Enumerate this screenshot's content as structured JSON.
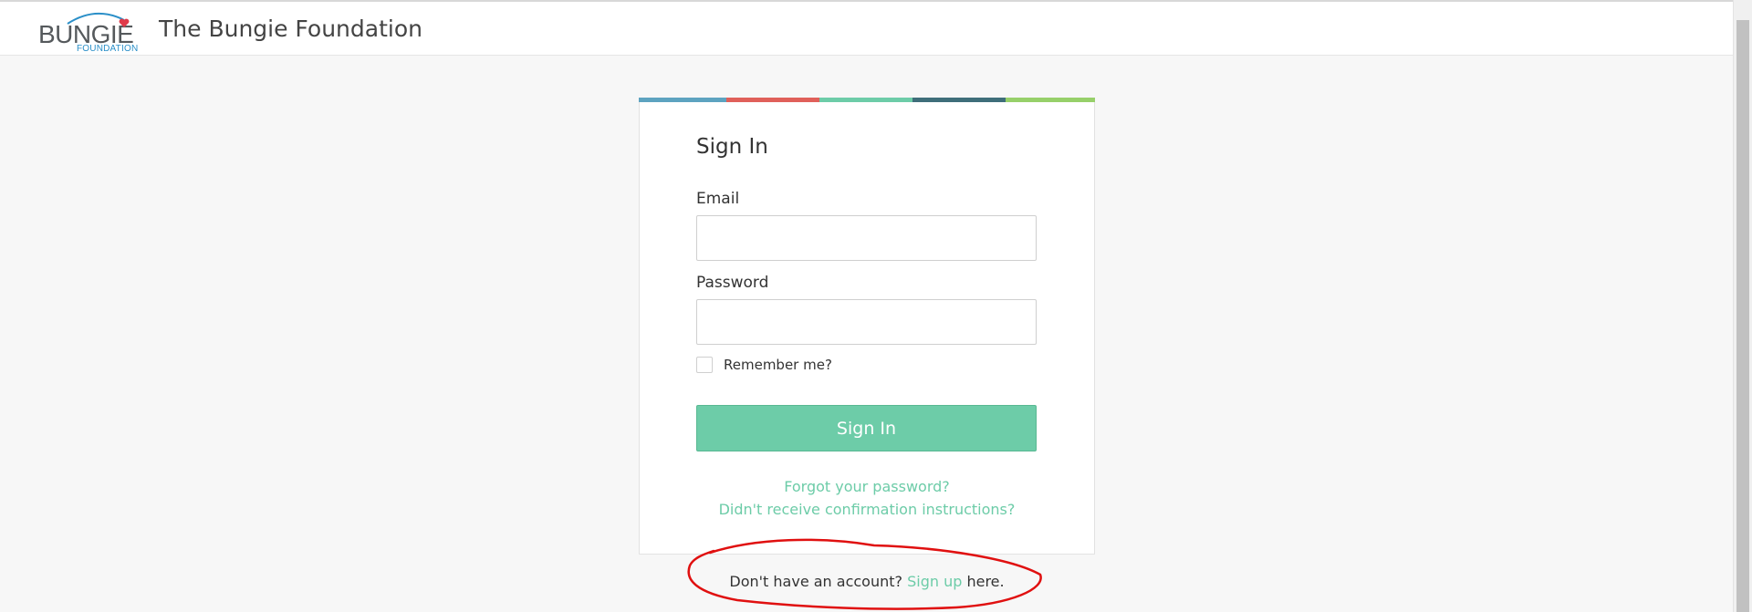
{
  "header": {
    "logo_word": "BUNGIE",
    "logo_sub": "FOUNDATION",
    "site_title": "The Bungie Foundation"
  },
  "stripe_colors": [
    "#5da3c0",
    "#e0605a",
    "#6dcca8",
    "#3f6e7a",
    "#97d06a"
  ],
  "form": {
    "title": "Sign In",
    "email_label": "Email",
    "email_value": "",
    "password_label": "Password",
    "password_value": "",
    "remember_label": "Remember me?",
    "remember_checked": false,
    "submit_label": "Sign In",
    "forgot_link": "Forgot your password?",
    "confirm_link": "Didn't receive confirmation instructions?"
  },
  "signup": {
    "prefix": "Don't have an account? ",
    "link": "Sign up",
    "suffix": " here."
  },
  "colors": {
    "accent": "#6dcca8",
    "annotation": "#e01010"
  }
}
